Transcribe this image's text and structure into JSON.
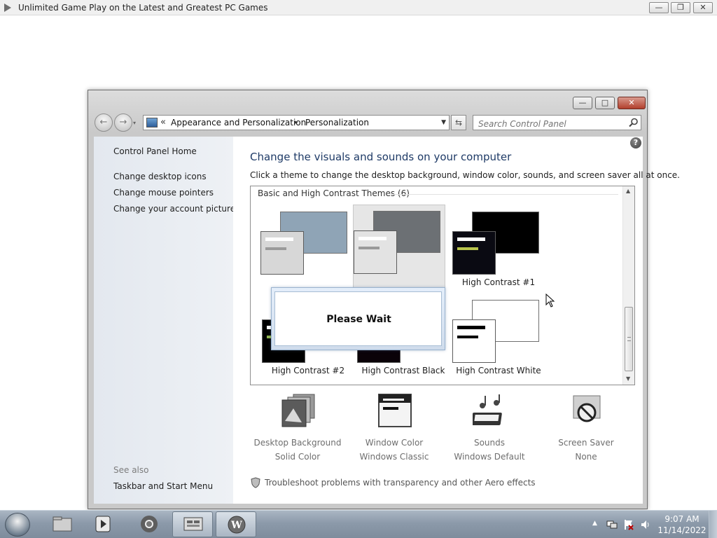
{
  "app_window": {
    "title": "Unlimited Game Play on the Latest and Greatest PC Games",
    "controls": {
      "minimize": "—",
      "restore": "❐",
      "close": "✕"
    }
  },
  "control_panel": {
    "controls": {
      "minimize": "—",
      "maximize": "□",
      "close": "✕"
    },
    "nav": {
      "back": "←",
      "forward": "→",
      "dropdown": "▾"
    },
    "address": {
      "chevron": "«",
      "separator": "▸",
      "crumbs": [
        "Appearance and Personalization",
        "Personalization"
      ],
      "dropdown": "▼"
    },
    "refresh": "⇆",
    "search": {
      "placeholder": "Search Control Panel"
    },
    "sidebar": {
      "home": "Control Panel Home",
      "links": [
        "Change desktop icons",
        "Change mouse pointers",
        "Change your account picture"
      ],
      "see_also_label": "See also",
      "see_also_links": [
        "Taskbar and Start Menu"
      ]
    },
    "content": {
      "help": "?",
      "title": "Change the visuals and sounds on your computer",
      "instruction": "Click a theme to change the desktop background, window color, sounds, and screen saver all at once.",
      "section_title": "Basic and High Contrast Themes (6)",
      "themes": [
        {
          "name": "",
          "back_color": "#8fa4b6",
          "front_color": "#d7d7d7",
          "bar1": "#ffffff",
          "bar2": "#9a9a9a"
        },
        {
          "name": "",
          "back_color": "#6c7074",
          "front_color": "#e3e3e3",
          "bar1": "#ffffff",
          "bar2": "#9a9a9a"
        },
        {
          "name": "High Contrast #1",
          "back_color": "#000000",
          "front_color": "#0a0a12",
          "bar1": "#ffffff",
          "bar2": "#b8c44c"
        },
        {
          "name": "High Contrast #2",
          "back_color": "#000000",
          "front_color": "#000000",
          "bar1": "#ffffff",
          "bar2": "#8fb34f"
        },
        {
          "name": "High Contrast Black",
          "back_color": "#000000",
          "front_color": "#0a0208",
          "bar1": "#ffe2ff",
          "bar2": "#ffffff"
        },
        {
          "name": "High Contrast White",
          "back_color": "#ffffff",
          "front_color": "#ffffff",
          "bar1": "#000000",
          "bar2": "#000000"
        }
      ],
      "please_wait": "Please Wait",
      "scroll_up": "▲",
      "scroll_down": "▼",
      "bottom": [
        {
          "icon": "desktop-background-icon",
          "label": "Desktop Background",
          "value": "Solid Color"
        },
        {
          "icon": "window-color-icon",
          "label": "Window Color",
          "value": "Windows Classic"
        },
        {
          "icon": "sounds-icon",
          "label": "Sounds",
          "value": "Windows Default"
        },
        {
          "icon": "screen-saver-icon",
          "label": "Screen Saver",
          "value": "None"
        }
      ],
      "troubleshoot": "Troubleshoot problems with transparency and other Aero effects"
    }
  },
  "taskbar": {
    "apps": [
      "explorer-icon",
      "media-player-icon",
      "chrome-icon",
      "control-panel-icon",
      "game-app-icon"
    ],
    "tray_arrow": "▲",
    "time": "9:07 AM",
    "date": "11/14/2022"
  }
}
